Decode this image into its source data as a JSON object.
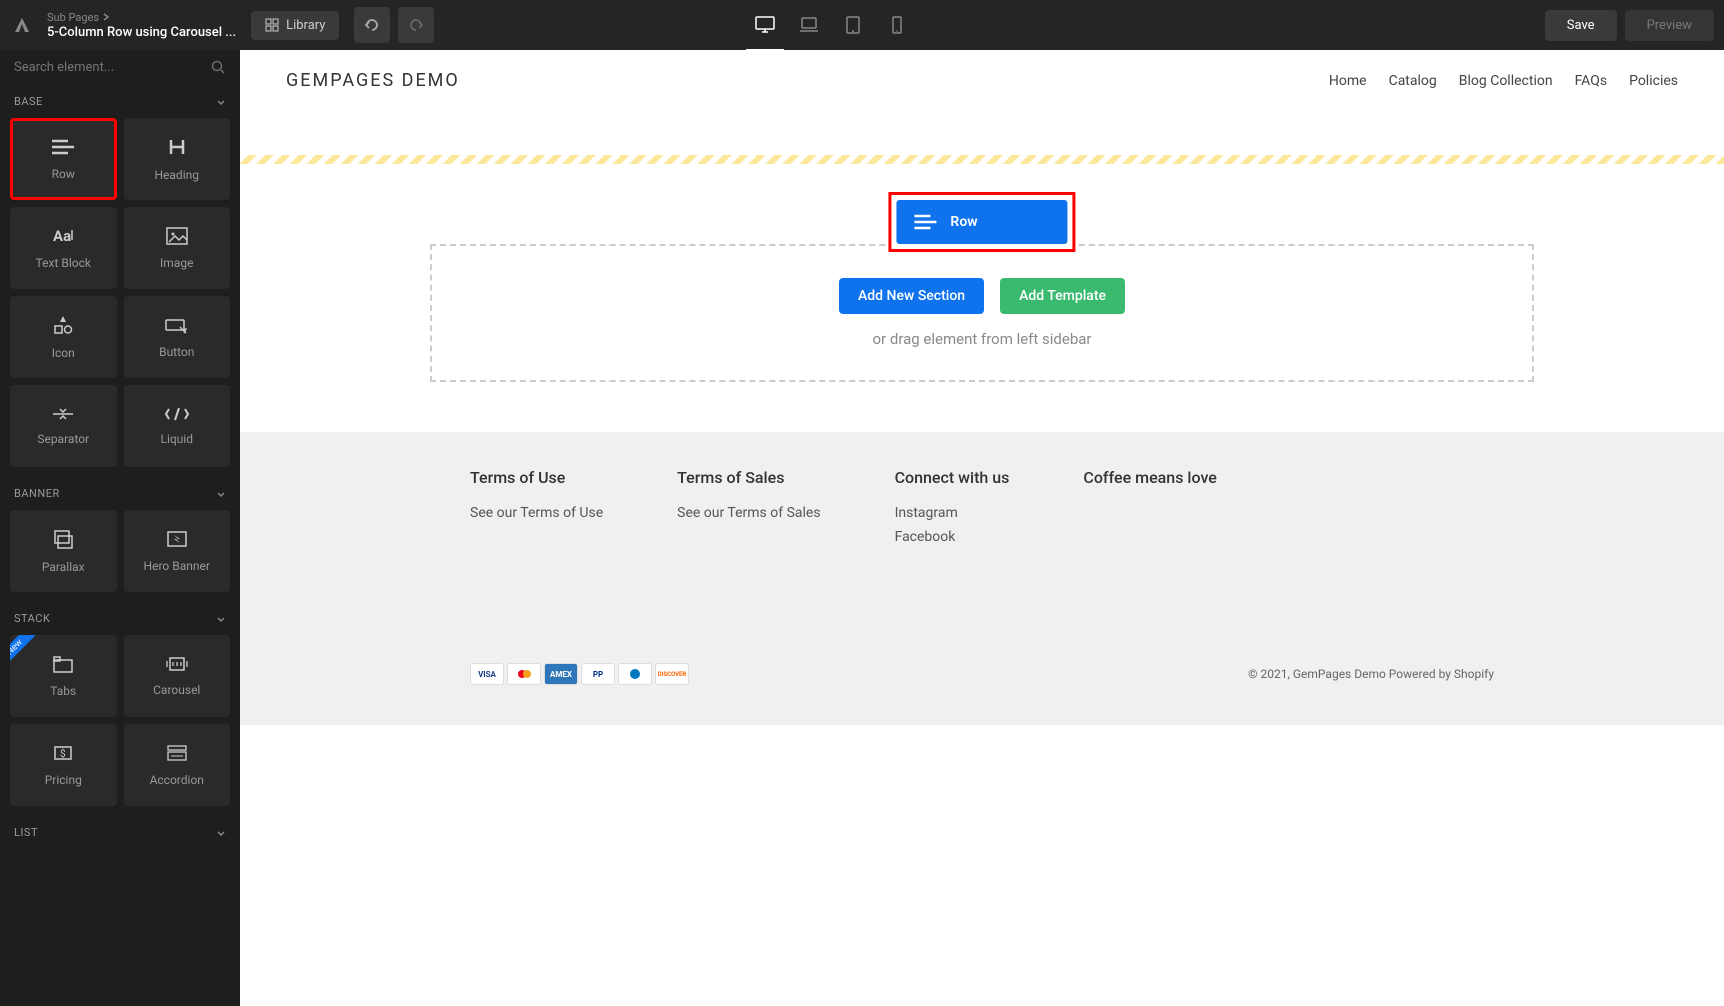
{
  "topbar": {
    "breadcrumb_parent": "Sub Pages",
    "breadcrumb_title": "5-Column Row using Carousel ...",
    "library": "Library",
    "save": "Save",
    "preview": "Preview"
  },
  "sidebar": {
    "search_placeholder": "Search element...",
    "sections": {
      "base": {
        "title": "BASE",
        "items": [
          "Row",
          "Heading",
          "Text Block",
          "Image",
          "Icon",
          "Button",
          "Separator",
          "Liquid"
        ]
      },
      "banner": {
        "title": "BANNER",
        "items": [
          "Parallax",
          "Hero Banner"
        ]
      },
      "stack": {
        "title": "STACK",
        "items": [
          "Tabs",
          "Carousel",
          "Pricing",
          "Accordion"
        ]
      },
      "list": {
        "title": "LIST"
      }
    }
  },
  "site": {
    "logo": "GEMPAGES DEMO",
    "nav": [
      "Home",
      "Catalog",
      "Blog Collection",
      "FAQs",
      "Policies"
    ]
  },
  "dropzone": {
    "drag_label": "Row",
    "add_section": "Add New Section",
    "add_template": "Add Template",
    "hint": "or drag element from left sidebar"
  },
  "footer": {
    "cols": [
      {
        "title": "Terms of Use",
        "links": [
          "See our Terms of Use"
        ]
      },
      {
        "title": "Terms of Sales",
        "links": [
          "See our Terms of Sales"
        ]
      },
      {
        "title": "Connect with us",
        "links": [
          "Instagram",
          "Facebook"
        ]
      },
      {
        "title": "Coffee means love",
        "links": []
      }
    ],
    "copyright": "© 2021, GemPages Demo Powered by Shopify",
    "payments": [
      "VISA",
      "MC",
      "AMEX",
      "PP",
      "DC",
      "DISC"
    ]
  }
}
